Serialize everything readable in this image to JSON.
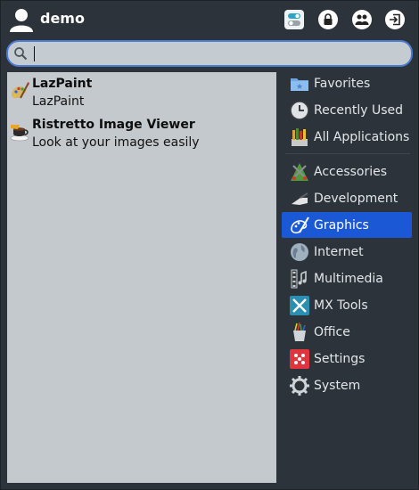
{
  "header": {
    "user_name": "demo",
    "buttons": [
      "settings-icon",
      "lock-icon",
      "switch-user-icon",
      "logout-icon"
    ]
  },
  "search": {
    "value": "",
    "placeholder": ""
  },
  "results": [
    {
      "title": "LazPaint",
      "description": "LazPaint",
      "icon": "lazpaint-icon"
    },
    {
      "title": "Ristretto Image Viewer",
      "description": "Look at your images easily",
      "icon": "ristretto-icon"
    }
  ],
  "categories": [
    {
      "label": "Favorites",
      "icon": "favorites-icon"
    },
    {
      "label": "Recently Used",
      "icon": "clock-icon"
    },
    {
      "label": "All Applications",
      "icon": "all-applications-icon"
    },
    {
      "label": "Accessories",
      "icon": "accessories-icon"
    },
    {
      "label": "Development",
      "icon": "development-icon"
    },
    {
      "label": "Graphics",
      "icon": "graphics-icon",
      "selected": true
    },
    {
      "label": "Internet",
      "icon": "globe-icon"
    },
    {
      "label": "Multimedia",
      "icon": "film-icon"
    },
    {
      "label": "MX Tools",
      "icon": "tools-icon"
    },
    {
      "label": "Office",
      "icon": "office-icon"
    },
    {
      "label": "Settings",
      "icon": "settings-icon"
    },
    {
      "label": "System",
      "icon": "gear-icon"
    }
  ],
  "colors": {
    "background": "#2c333b",
    "results_panel": "#c4c9cd",
    "selection": "#1b58d6",
    "search_border": "#4c7bd1"
  }
}
